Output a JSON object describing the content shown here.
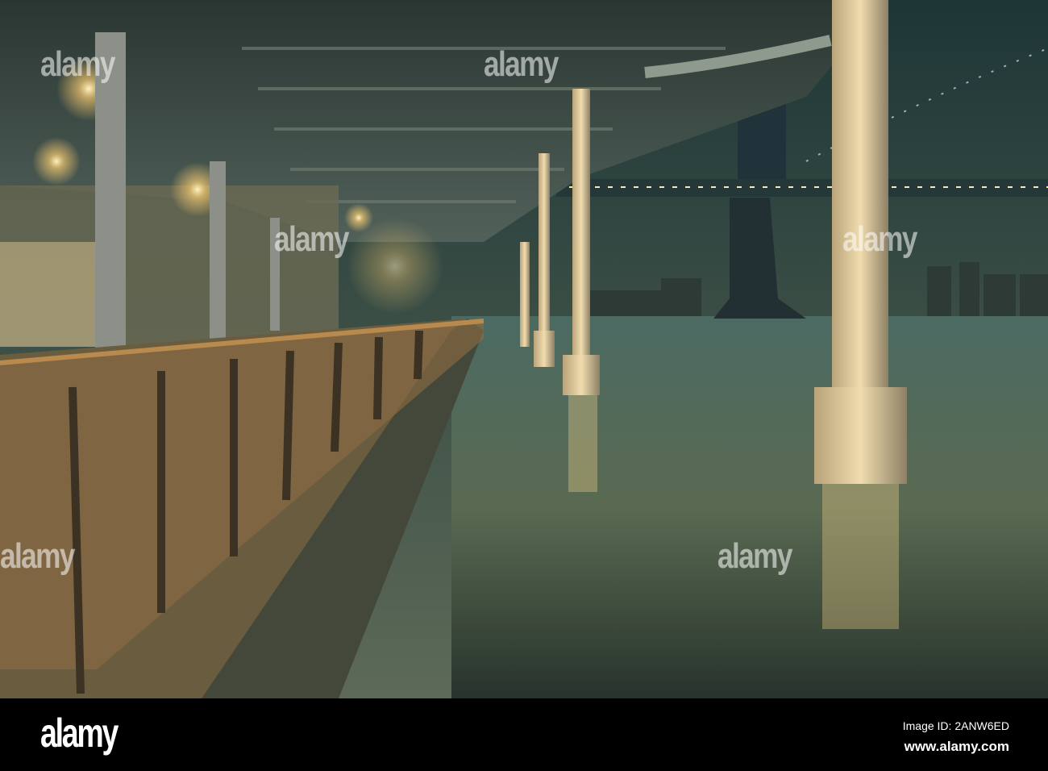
{
  "photo": {
    "subject": "Waterfront promenade under a bridge at night",
    "watermark_text": "alamy"
  },
  "footer": {
    "logo": "alamy",
    "image_id": "Image ID: 2ANW6ED",
    "url": "www.alamy.com"
  },
  "colors": {
    "structure": "#3c4c44",
    "water": "#3f5a52",
    "light": "#f6d48a",
    "sky": "#25413f"
  }
}
